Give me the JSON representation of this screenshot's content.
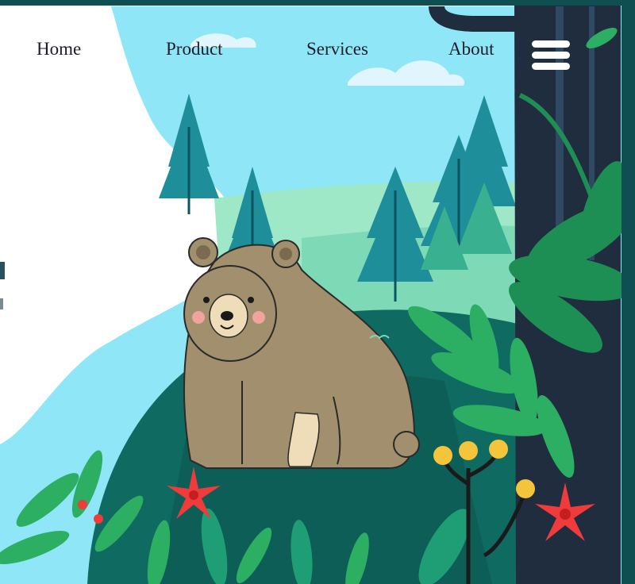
{
  "nav": {
    "home": "Home",
    "product": "Product",
    "services": "Services",
    "about": "About"
  },
  "menu": {
    "icon": "hamburger-menu-icon"
  },
  "colors": {
    "frame": "#0f4f51",
    "sky": "#8ee6f7",
    "tree_trunk_dark": "#1f2d3f",
    "meadow": "#9fe8c7",
    "hill": "#0f6a62",
    "bear": "#a18f6d",
    "leaves": "#1e8f54",
    "flower_red": "#ef3b3b",
    "berry_yellow": "#f4c53a"
  }
}
